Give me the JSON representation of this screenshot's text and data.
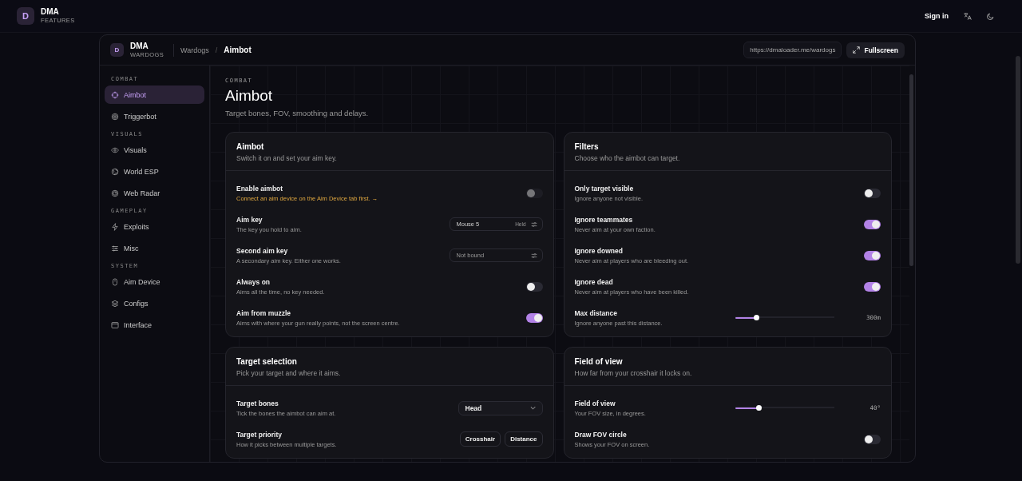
{
  "topbar": {
    "logo_letter": "D",
    "brand": "DMA",
    "brand_sub": "FEATURES",
    "sign_in": "Sign in"
  },
  "frame": {
    "logo_letter": "D",
    "brand": "DMA",
    "brand_sub": "WARDOGS",
    "breadcrumb": [
      "Wardogs",
      "Aimbot"
    ],
    "breadcrumb_separator": "/",
    "url": "https://dmaloader.me/wardogs",
    "fullscreen": "Fullscreen"
  },
  "sidebar": [
    {
      "heading": "COMBAT",
      "items": [
        {
          "label": "Aimbot",
          "selected": true
        },
        {
          "label": "Triggerbot",
          "selected": false
        }
      ]
    },
    {
      "heading": "VISUALS",
      "items": [
        {
          "label": "Visuals",
          "selected": false
        },
        {
          "label": "World ESP",
          "selected": false
        },
        {
          "label": "Web Radar",
          "selected": false
        }
      ]
    },
    {
      "heading": "GAMEPLAY",
      "items": [
        {
          "label": "Exploits",
          "selected": false
        },
        {
          "label": "Misc",
          "selected": false
        }
      ]
    },
    {
      "heading": "SYSTEM",
      "items": [
        {
          "label": "Aim Device",
          "selected": false
        },
        {
          "label": "Configs",
          "selected": false
        },
        {
          "label": "Interface",
          "selected": false
        }
      ]
    }
  ],
  "page": {
    "eyebrow": "COMBAT",
    "title": "Aimbot",
    "subtitle": "Target bones, FOV, smoothing and delays."
  },
  "cards": [
    {
      "title": "Aimbot",
      "subtitle": "Switch it on and set your aim key.",
      "rows": [
        {
          "kind": "toggle",
          "label": "Enable aimbot",
          "hint": "Connect an aim device on the Aim Device tab first. →",
          "warning": true,
          "on": false,
          "disabled": true
        },
        {
          "kind": "key",
          "label": "Aim key",
          "hint": "The key you hold to aim.",
          "value": "Mouse 5",
          "mode": "Held"
        },
        {
          "kind": "key",
          "label": "Second aim key",
          "hint": "A secondary aim key. Either one works.",
          "placeholder": "Not bound"
        },
        {
          "kind": "toggle",
          "label": "Always on",
          "hint": "Aims all the time, no key needed.",
          "on": false,
          "disabled": false
        },
        {
          "kind": "toggle",
          "label": "Aim from muzzle",
          "hint": "Aims with where your gun really points, not the screen centre.",
          "on": true,
          "disabled": false
        }
      ]
    },
    {
      "title": "Filters",
      "subtitle": "Choose who the aimbot can target.",
      "rows": [
        {
          "kind": "toggle",
          "label": "Only target visible",
          "hint": "Ignore anyone not visible.",
          "on": false,
          "disabled": false
        },
        {
          "kind": "toggle",
          "label": "Ignore teammates",
          "hint": "Never aim at your own faction.",
          "on": true,
          "disabled": false
        },
        {
          "kind": "toggle",
          "label": "Ignore downed",
          "hint": "Never aim at players who are bleeding out.",
          "on": true,
          "disabled": false
        },
        {
          "kind": "toggle",
          "label": "Ignore dead",
          "hint": "Never aim at players who have been killed.",
          "on": true,
          "disabled": false
        },
        {
          "kind": "slider",
          "label": "Max distance",
          "hint": "Ignore anyone past this distance.",
          "level": 0.21,
          "reading": "300m"
        }
      ]
    },
    {
      "title": "Target selection",
      "subtitle": "Pick your target and where it aims.",
      "rows": [
        {
          "kind": "select",
          "label": "Target bones",
          "hint": "Tick the bones the aimbot can aim at.",
          "value": "Head"
        },
        {
          "kind": "segmented",
          "label": "Target priority",
          "hint": "How it picks between multiple targets.",
          "options": [
            {
              "label": "Crosshair",
              "selected": false
            },
            {
              "label": "Distance",
              "selected": false
            }
          ]
        }
      ]
    },
    {
      "title": "Field of view",
      "subtitle": "How far from your crosshair it locks on.",
      "rows": [
        {
          "kind": "slider",
          "label": "Field of view",
          "hint": "Your FOV size, in degrees.",
          "level": 0.23,
          "reading": "40°"
        },
        {
          "kind": "toggle",
          "label": "Draw FOV circle",
          "hint": "Shows your FOV on screen.",
          "on": false,
          "disabled": false
        }
      ]
    }
  ]
}
